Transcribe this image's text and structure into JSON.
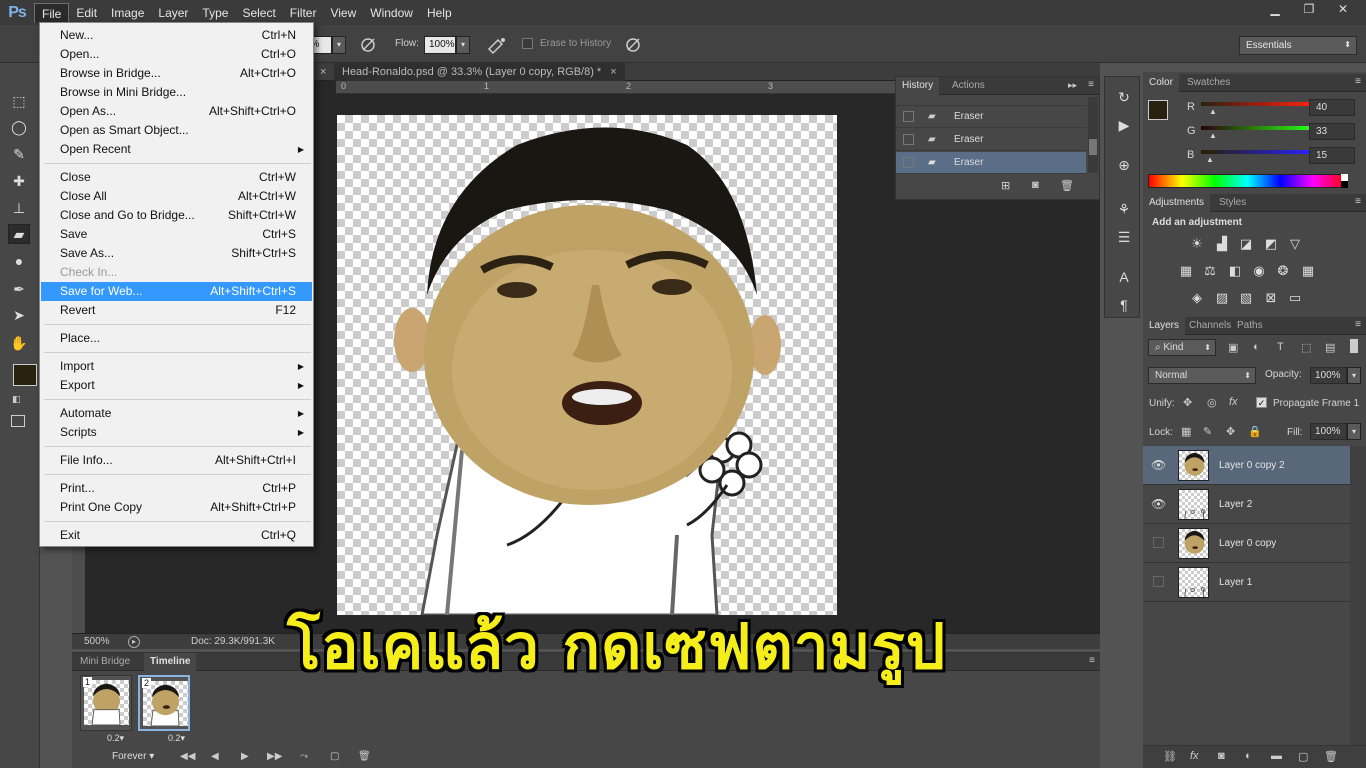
{
  "app": {
    "logo": "Ps"
  },
  "menubar": [
    "File",
    "Edit",
    "Image",
    "Layer",
    "Type",
    "Select",
    "Filter",
    "View",
    "Window",
    "Help"
  ],
  "window_controls": {
    "minimize": "▁",
    "restore": "❐",
    "close": "✕"
  },
  "options": {
    "opacity_value": "0%",
    "flow_label": "Flow:",
    "flow_value": "100%",
    "erase_history_label": "Erase to History",
    "workspace": "Essentials"
  },
  "file_menu": [
    {
      "label": "New...",
      "shortcut": "Ctrl+N"
    },
    {
      "label": "Open...",
      "shortcut": "Ctrl+O"
    },
    {
      "label": "Browse in Bridge...",
      "shortcut": "Alt+Ctrl+O"
    },
    {
      "label": "Browse in Mini Bridge...",
      "shortcut": ""
    },
    {
      "label": "Open As...",
      "shortcut": "Alt+Shift+Ctrl+O"
    },
    {
      "label": "Open as Smart Object...",
      "shortcut": ""
    },
    {
      "label": "Open Recent",
      "shortcut": "",
      "submenu": true
    },
    {
      "label": "Close",
      "shortcut": "Ctrl+W"
    },
    {
      "label": "Close All",
      "shortcut": "Alt+Ctrl+W"
    },
    {
      "label": "Close and Go to Bridge...",
      "shortcut": "Shift+Ctrl+W"
    },
    {
      "label": "Save",
      "shortcut": "Ctrl+S"
    },
    {
      "label": "Save As...",
      "shortcut": "Shift+Ctrl+S"
    },
    {
      "label": "Check In...",
      "shortcut": "",
      "disabled": true
    },
    {
      "label": "Save for Web...",
      "shortcut": "Alt+Shift+Ctrl+S",
      "highlighted": true
    },
    {
      "label": "Revert",
      "shortcut": "F12"
    },
    {
      "label": "Place...",
      "shortcut": ""
    },
    {
      "label": "Import",
      "shortcut": "",
      "submenu": true
    },
    {
      "label": "Export",
      "shortcut": "",
      "submenu": true
    },
    {
      "label": "Automate",
      "shortcut": "",
      "submenu": true
    },
    {
      "label": "Scripts",
      "shortcut": "",
      "submenu": true
    },
    {
      "label": "File Info...",
      "shortcut": "Alt+Shift+Ctrl+I"
    },
    {
      "label": "Print...",
      "shortcut": "Ctrl+P"
    },
    {
      "label": "Print One Copy",
      "shortcut": "Alt+Shift+Ctrl+P"
    },
    {
      "label": "Exit",
      "shortcut": "Ctrl+Q"
    }
  ],
  "document": {
    "tab_title": "Head-Ronaldo.psd @ 33.3% (Layer 0 copy, RGB/8) *",
    "tab_close": "×",
    "ruler_marks": [
      "0",
      "1",
      "2",
      "3"
    ],
    "zoom": "500%",
    "doc_info": "Doc: 29.3K/991.3K"
  },
  "history": {
    "tabs": [
      "History",
      "Actions"
    ],
    "items": [
      "Eraser",
      "Eraser",
      "Eraser"
    ]
  },
  "color_panel": {
    "tabs": [
      "Color",
      "Swatches"
    ],
    "r_label": "R",
    "g_label": "G",
    "b_label": "B",
    "r": "40",
    "g": "33",
    "b": "15",
    "foreground": "#28210f"
  },
  "adjustments": {
    "tabs": [
      "Adjustments",
      "Styles"
    ],
    "title": "Add an adjustment"
  },
  "layers": {
    "tabs": [
      "Layers",
      "Channels",
      "Paths"
    ],
    "filter": "Kind",
    "blend_mode": "Normal",
    "opacity_label": "Opacity:",
    "opacity": "100%",
    "unify_label": "Unify:",
    "propagate": "Propagate Frame 1",
    "lock_label": "Lock:",
    "fill_label": "Fill:",
    "fill": "100%",
    "items": [
      {
        "name": "Layer 0 copy 2",
        "visible": true,
        "selected": true,
        "thumb": "face"
      },
      {
        "name": "Layer 2",
        "visible": true,
        "selected": false,
        "thumb": "body"
      },
      {
        "name": "Layer 0 copy",
        "visible": false,
        "selected": false,
        "thumb": "face"
      },
      {
        "name": "Layer 1",
        "visible": false,
        "selected": false,
        "thumb": "body"
      }
    ]
  },
  "timeline": {
    "tabs": [
      "Mini Bridge",
      "Timeline"
    ],
    "frames": [
      {
        "num": "1",
        "delay": "0.2▾"
      },
      {
        "num": "2",
        "delay": "0.2▾"
      }
    ],
    "loop": "Forever"
  },
  "caption": "โอเคแล้ว กดเซฟตามรูป"
}
